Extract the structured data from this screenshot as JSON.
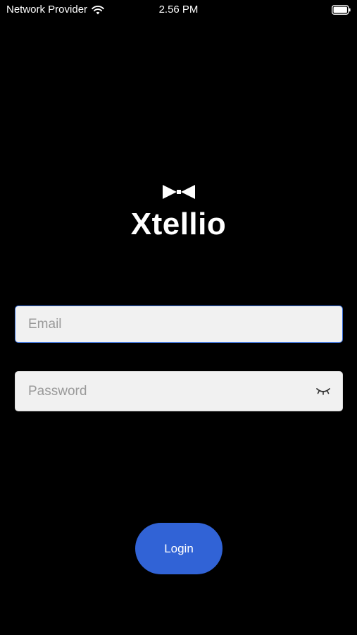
{
  "status_bar": {
    "carrier": "Network Provider",
    "time": "2.56 PM",
    "wifi_icon": "wifi-icon",
    "battery_icon": "battery-icon"
  },
  "logo": {
    "icon": "bowtie-icon",
    "brand": "Xtellio"
  },
  "form": {
    "email_placeholder": "Email",
    "email_value": "",
    "password_placeholder": "Password",
    "password_value": "",
    "password_toggle_icon": "eye-closed-icon",
    "login_label": "Login"
  },
  "colors": {
    "background": "#000000",
    "field_background": "#f1f1f1",
    "focus_border": "#3a6fd8",
    "button": "#3163d6",
    "text": "#ffffff"
  }
}
